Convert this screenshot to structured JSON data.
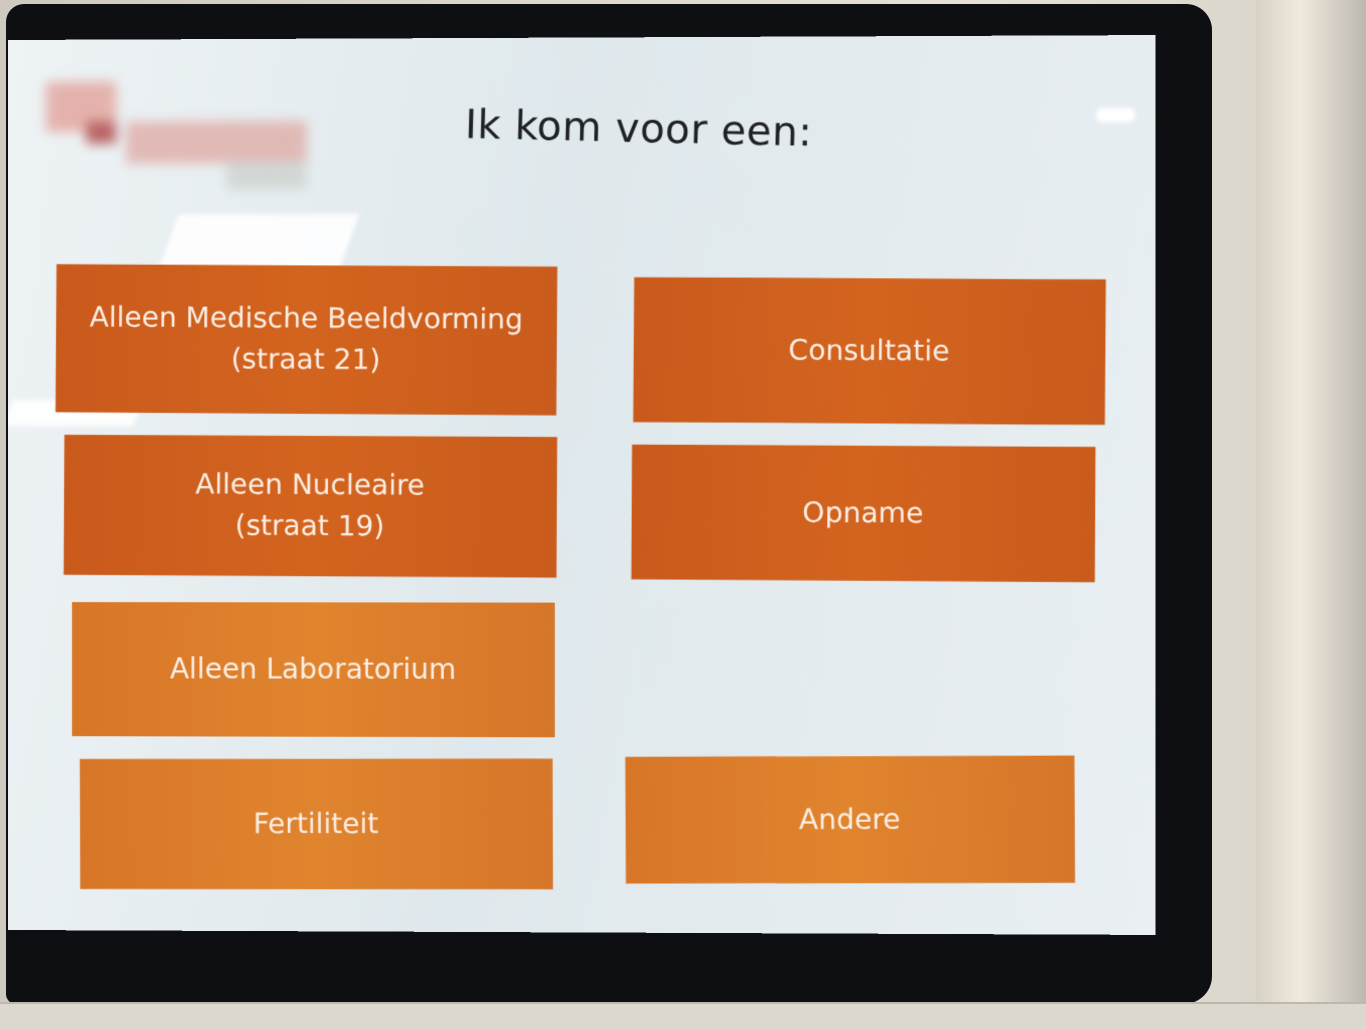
{
  "screen": {
    "title": "Ik kom voor een:"
  },
  "options": {
    "medische_beeldvorming": {
      "line1": "Alleen Medische Beeldvorming",
      "line2": "(straat 21)"
    },
    "nucleaire": {
      "line1": "Alleen Nucleaire",
      "line2": "(straat 19)"
    },
    "laboratorium": {
      "label": "Alleen Laboratorium"
    },
    "fertiliteit": {
      "label": "Fertiliteit"
    },
    "consultatie": {
      "label": "Consultatie"
    },
    "opname": {
      "label": "Opname"
    },
    "andere": {
      "label": "Andere"
    }
  },
  "colors": {
    "tile_primary": "#d3641f",
    "tile_light": "#e0842e",
    "tile_text": "#fbeee4",
    "screen_bg": "#e6edf0",
    "bezel": "#0e0f12"
  }
}
